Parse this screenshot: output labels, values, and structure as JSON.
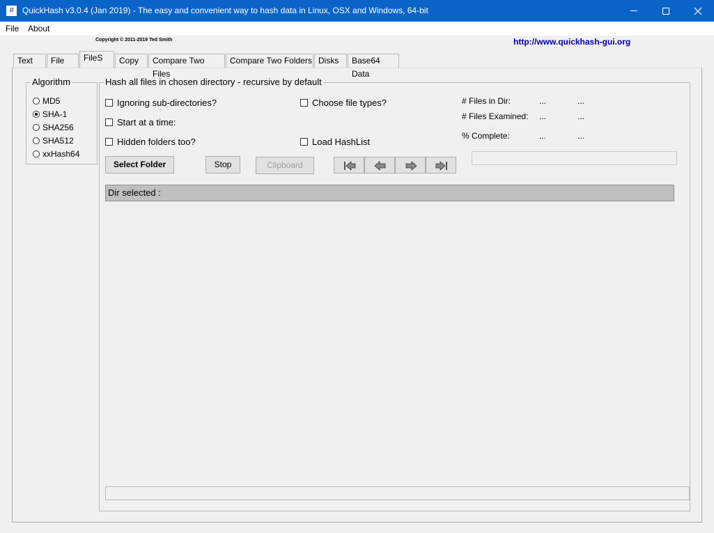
{
  "window": {
    "title": "QuickHash v3.0.4 (Jan 2019) - The easy and convenient way to hash data in Linux, OSX and Windows, 64-bit",
    "icon": "#"
  },
  "menu": {
    "file": "File",
    "about": "About"
  },
  "header": {
    "copyright": "Copyright © 2011-2019  Ted Smith",
    "url": "http://www.quickhash-gui.org"
  },
  "tabs": [
    {
      "label": "Text"
    },
    {
      "label": "File"
    },
    {
      "label": "FileS"
    },
    {
      "label": "Copy"
    },
    {
      "label": "Compare Two Files"
    },
    {
      "label": "Compare Two Folders"
    },
    {
      "label": "Disks"
    },
    {
      "label": "Base64 Data"
    }
  ],
  "algorithm": {
    "legend": "Algorithm",
    "options": [
      {
        "label": "MD5",
        "selected": false
      },
      {
        "label": "SHA-1",
        "selected": true
      },
      {
        "label": "SHA256",
        "selected": false
      },
      {
        "label": "SHA512",
        "selected": false
      },
      {
        "label": "xxHash64",
        "selected": false
      }
    ]
  },
  "files_panel": {
    "legend": "Hash all files in chosen directory - recursive by default",
    "checkboxes": {
      "ignore_subdirs": "Ignoring sub-directories?",
      "start_at_time": "Start at a time:",
      "hidden_folders": "Hidden folders too?",
      "choose_types": "Choose file types?",
      "load_hashlist": "Load HashList"
    },
    "buttons": {
      "select_folder": "Select Folder",
      "stop": "Stop",
      "clipboard": "Clipboard"
    },
    "stats": {
      "files_in_dir_label": "# Files in Dir:",
      "files_in_dir_value": "...",
      "files_in_dir_value2": "...",
      "files_examined_label": "# Files Examined:",
      "files_examined_value": "...",
      "files_examined_value2": "...",
      "complete_label": "% Complete:",
      "complete_value": "...",
      "complete_value2": "..."
    },
    "dir_selected": "Dir selected :"
  }
}
